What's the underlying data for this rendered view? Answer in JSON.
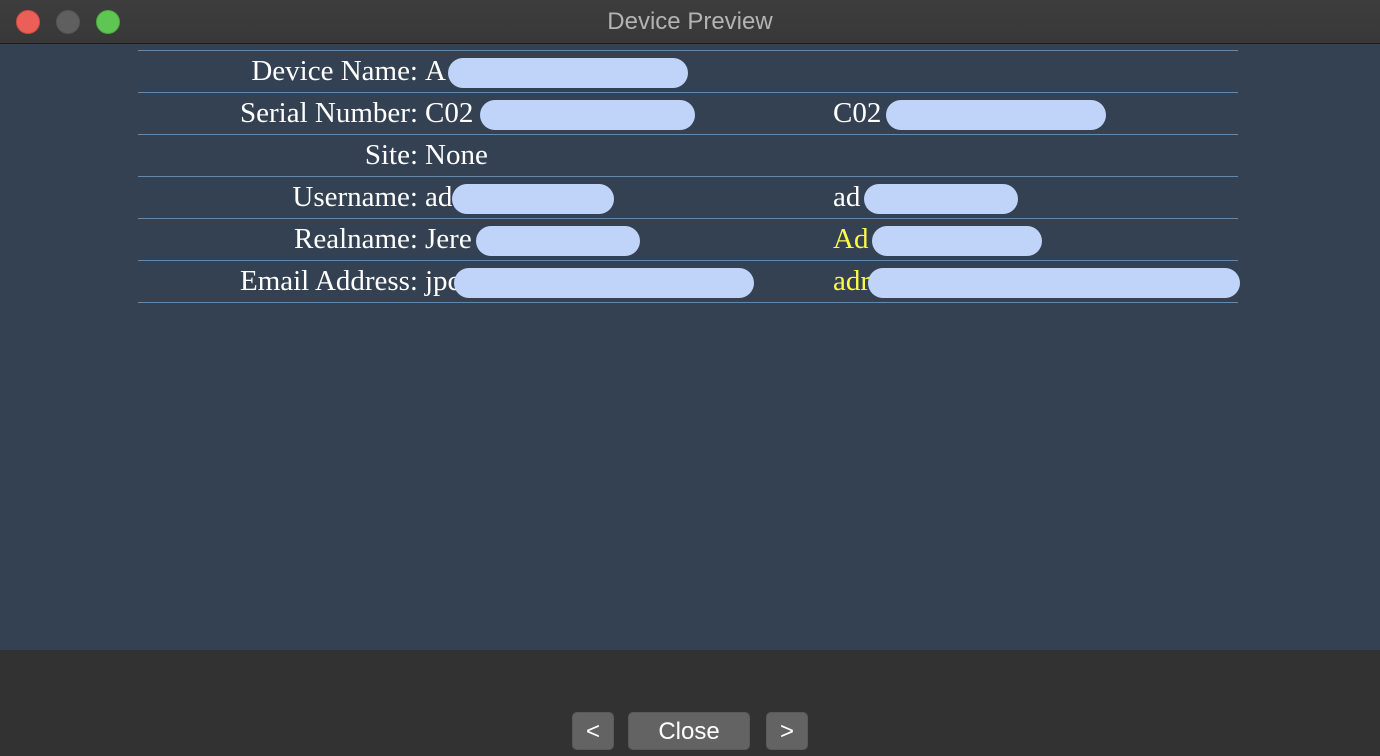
{
  "window": {
    "title": "Device Preview"
  },
  "rows": [
    {
      "label": "Device Name:",
      "value1": "A",
      "value2": ""
    },
    {
      "label": "Serial Number:",
      "value1": "C02",
      "value2": "C02"
    },
    {
      "label": "Site:",
      "value1": "None",
      "value2": ""
    },
    {
      "label": "Username:",
      "value1": "ad",
      "value2": "ad"
    },
    {
      "label": "Realname:",
      "value1": "Jere",
      "value2": "Ad"
    },
    {
      "label": "Email Address:",
      "value1": "jpc",
      "value2": "adr"
    }
  ],
  "colors": {
    "content_bg": "#334152",
    "row_divider": "#6289ad",
    "highlight_text": "#fbfb46",
    "redaction": "#c0d4fa"
  },
  "footer": {
    "prev_label": "<",
    "close_label": "Close",
    "next_label": ">"
  }
}
